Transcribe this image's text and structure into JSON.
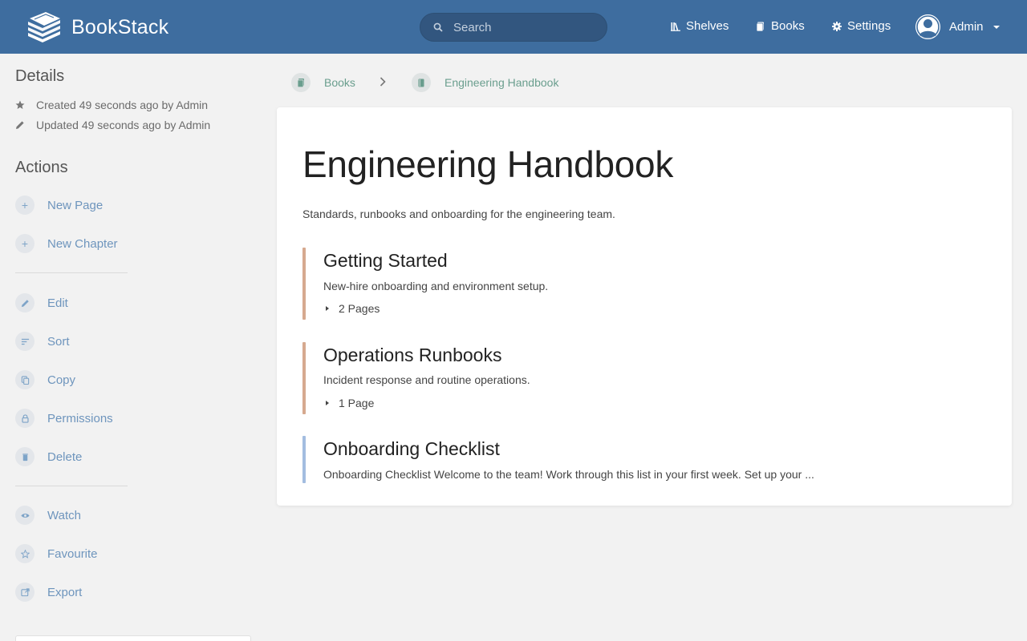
{
  "header": {
    "app_name": "BookStack",
    "search_placeholder": "Search",
    "nav": [
      {
        "label": "Shelves",
        "icon": "shelves-icon"
      },
      {
        "label": "Books",
        "icon": "books-icon"
      },
      {
        "label": "Settings",
        "icon": "gear-icon"
      }
    ],
    "user_name": "Admin"
  },
  "sidebar": {
    "details_heading": "Details",
    "created": "Created 49 seconds ago by Admin",
    "updated": "Updated 49 seconds ago by Admin",
    "actions_heading": "Actions",
    "actions": [
      {
        "label": "New Page",
        "icon": "plus-icon"
      },
      {
        "label": "New Chapter",
        "icon": "plus-icon"
      },
      {
        "label": "Edit",
        "icon": "pencil-icon"
      },
      {
        "label": "Sort",
        "icon": "sort-icon"
      },
      {
        "label": "Copy",
        "icon": "copy-icon"
      },
      {
        "label": "Permissions",
        "icon": "lock-icon"
      },
      {
        "label": "Delete",
        "icon": "trash-icon"
      },
      {
        "label": "Watch",
        "icon": "eye-icon"
      },
      {
        "label": "Favourite",
        "icon": "star-icon"
      },
      {
        "label": "Export",
        "icon": "export-icon"
      }
    ]
  },
  "breadcrumb": {
    "items": [
      {
        "label": "Books",
        "icon": "books-icon"
      },
      {
        "label": "Engineering Handbook",
        "icon": "book-icon"
      }
    ]
  },
  "book": {
    "title": "Engineering Handbook",
    "description": "Standards, runbooks and onboarding for the engineering team.",
    "entries": [
      {
        "type": "chapter",
        "title": "Getting Started",
        "description": "New-hire onboarding and environment setup.",
        "pages": "2 Pages",
        "color": "#d6a98f"
      },
      {
        "type": "chapter",
        "title": "Operations Runbooks",
        "description": "Incident response and routine operations.",
        "pages": "1 Page",
        "color": "#d6a98f"
      },
      {
        "type": "page",
        "title": "Onboarding Checklist",
        "description": "Onboarding Checklist Welcome to the team! Work through this list in your first week. Set up your ...",
        "color": "#a3bde0"
      }
    ]
  },
  "colors": {
    "header_bg": "#3e6d9f",
    "link": "#6e95bd",
    "breadcrumb": "#6a9e8e",
    "chapter_bar": "#d6a98f",
    "page_bar": "#a3bde0"
  }
}
